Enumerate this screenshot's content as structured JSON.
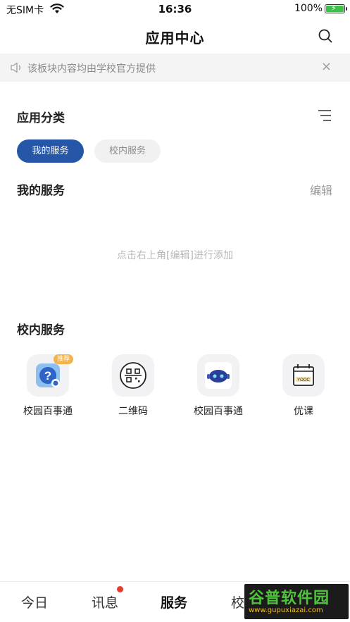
{
  "status_bar": {
    "carrier": "无SIM卡",
    "time": "16:36",
    "battery_percent": "100%",
    "battery_level": 1.0
  },
  "header": {
    "title": "应用中心",
    "search_icon": "search-icon"
  },
  "notice": {
    "text": "该板块内容均由学校官方提供",
    "close_label": "×"
  },
  "category": {
    "title": "应用分类",
    "tabs": [
      {
        "label": "我的服务",
        "active": true
      },
      {
        "label": "校内服务",
        "active": false
      }
    ]
  },
  "my_services": {
    "title": "我的服务",
    "edit_label": "编辑",
    "empty_hint": "点击右上角[编辑]进行添加"
  },
  "campus_services": {
    "title": "校内服务",
    "apps": [
      {
        "label": "校园百事通",
        "icon": "help-question-icon",
        "badge": "推荐"
      },
      {
        "label": "二维码",
        "icon": "qr-scan-icon"
      },
      {
        "label": "校园百事通",
        "icon": "robot-icon"
      },
      {
        "label": "优课",
        "icon": "yooc-calendar-icon"
      }
    ]
  },
  "tab_bar": {
    "tabs": [
      {
        "label": "今日"
      },
      {
        "label": "讯息",
        "has_dot": true
      },
      {
        "label": "服务",
        "active": true
      },
      {
        "label": "校"
      }
    ]
  },
  "watermark": {
    "title": "谷普软件园",
    "url": "www.gupuxiazai.com"
  },
  "colors": {
    "accent": "#2656a8",
    "badge": "#f4b24a",
    "notification_dot": "#e83b30"
  }
}
